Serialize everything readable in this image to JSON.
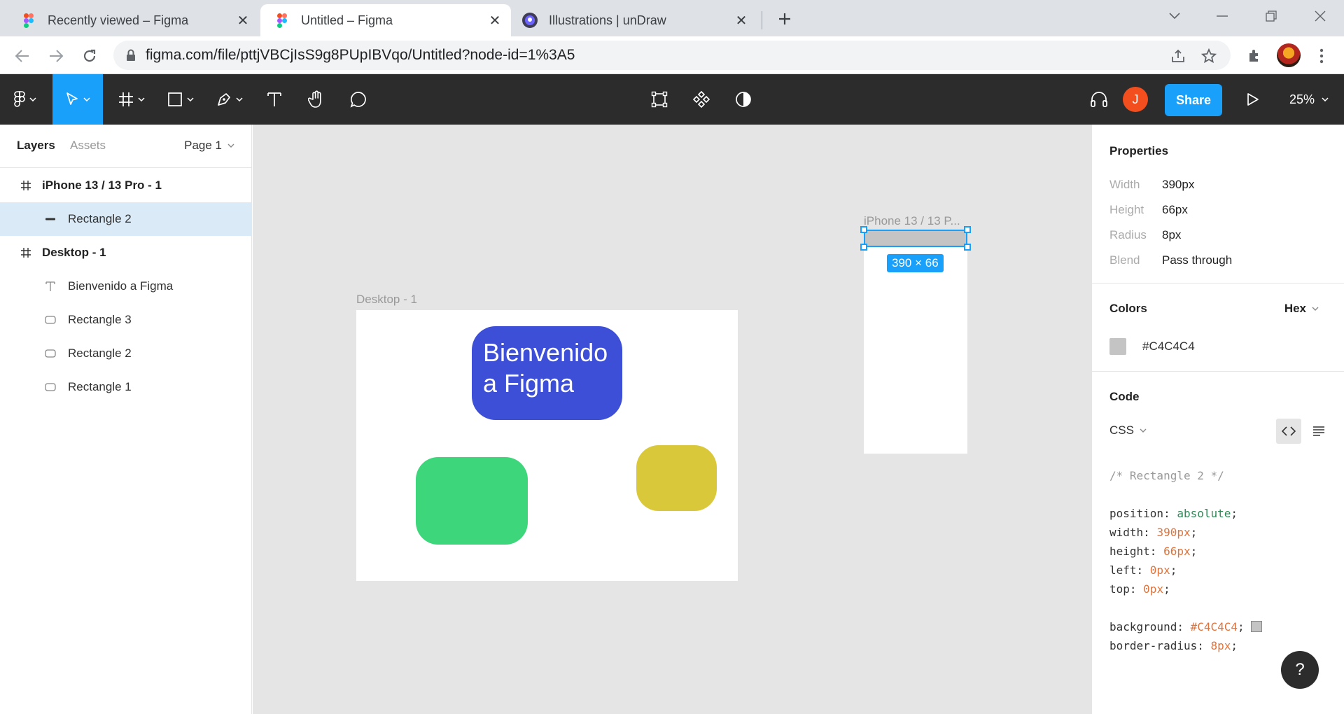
{
  "browser": {
    "tabs": [
      {
        "title": "Recently viewed – Figma",
        "icon": "figma-logo-icon",
        "active": false
      },
      {
        "title": "Untitled – Figma",
        "icon": "figma-logo-icon",
        "active": true
      },
      {
        "title": "Illustrations | unDraw",
        "icon": "undraw-logo-icon",
        "active": false
      }
    ],
    "close_glyph": "✕",
    "url": "figma.com/file/pttjVBCjIsS9g8PUpIBVqo/Untitled?node-id=1%3A5"
  },
  "toolbar": {
    "share_label": "Share",
    "user_initial": "J",
    "zoom_label": "25%",
    "accent": "#18a0fb",
    "bg": "#2c2c2c"
  },
  "left_panel": {
    "tabs": [
      "Layers",
      "Assets"
    ],
    "page_label": "Page 1",
    "layers": [
      {
        "name": "iPhone 13 / 13 Pro - 1",
        "type": "frame",
        "icon": "frame-icon",
        "selected": false
      },
      {
        "name": "Rectangle 2",
        "type": "rectangle",
        "icon": "rectangle-line-icon",
        "selected": true
      },
      {
        "name": "Desktop - 1",
        "type": "frame",
        "icon": "frame-icon",
        "selected": false
      },
      {
        "name": "Bienvenido a Figma",
        "type": "text",
        "icon": "text-icon",
        "selected": false
      },
      {
        "name": "Rectangle 3",
        "type": "rectangle",
        "icon": "rounded-rectangle-icon",
        "selected": false
      },
      {
        "name": "Rectangle 2",
        "type": "rectangle",
        "icon": "rounded-rectangle-icon",
        "selected": false
      },
      {
        "name": "Rectangle 1",
        "type": "rectangle",
        "icon": "rounded-rectangle-icon",
        "selected": false
      }
    ]
  },
  "canvas": {
    "desktop_label": "Desktop - 1",
    "welcome_line1": "Bienvenido",
    "welcome_line2": "a Figma",
    "iphone_label": "iPhone 13 / 13 P...",
    "size_tag": "390 × 66",
    "colors": {
      "welcome": "#3d4fd6",
      "green": "#3dd67a",
      "yellow": "#d8c83a",
      "selection": "#c4c4c4"
    }
  },
  "right_panel": {
    "properties_title": "Properties",
    "properties": [
      {
        "key": "Width",
        "value": "390px"
      },
      {
        "key": "Height",
        "value": "66px"
      },
      {
        "key": "Radius",
        "value": "8px"
      },
      {
        "key": "Blend",
        "value": "Pass through"
      }
    ],
    "colors_title": "Colors",
    "color_format": "Hex",
    "color_value": "#C4C4C4",
    "code_title": "Code",
    "code_lang": "CSS",
    "code": {
      "comment": "/* Rectangle 2 */",
      "lines": [
        {
          "prop": "position",
          "value": "absolute",
          "kind": "kw"
        },
        {
          "prop": "width",
          "value": "390px",
          "kind": "val"
        },
        {
          "prop": "height",
          "value": "66px",
          "kind": "val"
        },
        {
          "prop": "left",
          "value": "0px",
          "kind": "val"
        },
        {
          "prop": "top",
          "value": "0px",
          "kind": "val"
        }
      ],
      "lines2": [
        {
          "prop": "background",
          "value": "#C4C4C4",
          "kind": "val"
        },
        {
          "prop": "border-radius",
          "value": "8px",
          "kind": "val"
        }
      ]
    },
    "help_label": "?"
  }
}
